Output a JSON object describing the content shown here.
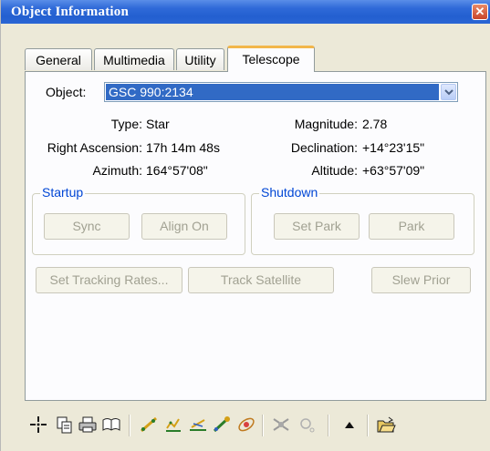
{
  "window": {
    "title": "Object Information",
    "close_glyph": "✕"
  },
  "tabs": [
    {
      "label": "General"
    },
    {
      "label": "Multimedia"
    },
    {
      "label": "Utility"
    },
    {
      "label": "Telescope",
      "active": true
    }
  ],
  "object": {
    "label": "Object:",
    "value": "GSC 990:2134"
  },
  "info": {
    "type_label": "Type:",
    "type_value": "Star",
    "magnitude_label": "Magnitude:",
    "magnitude_value": "2.78",
    "ra_label": "Right Ascension:",
    "ra_value": "17h 14m 48s",
    "dec_label": "Declination:",
    "dec_value": "+14°23'15\"",
    "azimuth_label": "Azimuth:",
    "azimuth_value": "164°57'08\"",
    "altitude_label": "Altitude:",
    "altitude_value": "+63°57'09\""
  },
  "startup": {
    "legend": "Startup",
    "sync_label": "Sync",
    "align_label": "Align On"
  },
  "shutdown": {
    "legend": "Shutdown",
    "set_park_label": "Set Park",
    "park_label": "Park"
  },
  "actions": {
    "tracking_label": "Set Tracking Rates...",
    "track_satellite_label": "Track Satellite",
    "slew_prior_label": "Slew Prior"
  },
  "toolbar_icons": [
    "center-star-icon",
    "copy-icon",
    "print-icon",
    "book-icon",
    "measure-icon",
    "chart-icon",
    "path-icon",
    "link-icon",
    "orbit-icon",
    "eclipse-icon",
    "disabled-tool-icon",
    "up-arrow-icon",
    "open-folder-icon"
  ],
  "colors": {
    "title_bar": "#235fd0",
    "accent_tab": "#f2b64a",
    "selection": "#316ac5",
    "group_legend": "#0046d5",
    "disabled_text": "#a1a192"
  }
}
